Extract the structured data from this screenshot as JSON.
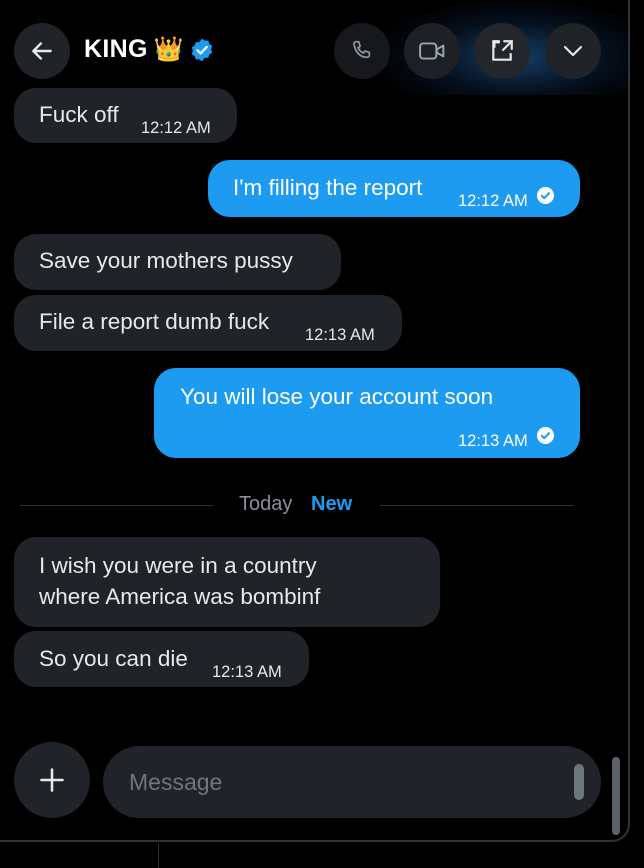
{
  "header": {
    "title": "KING",
    "title_emoji": "👑",
    "icons": [
      "back-arrow-icon",
      "phone-icon",
      "video-camera-icon",
      "expand-icon",
      "chevron-down-icon"
    ],
    "accent_color": "#1d9bf0"
  },
  "messages": [
    {
      "direction": "in",
      "text": "Fuck off",
      "time": "12:12 AM"
    },
    {
      "direction": "out",
      "text": "I'm filling the report",
      "time": "12:12 AM",
      "read": true
    },
    {
      "direction": "in",
      "text": "Save your mothers pussy"
    },
    {
      "direction": "in",
      "text": "File a report dumb fuck",
      "time": "12:13 AM"
    },
    {
      "direction": "out",
      "text": "You will lose your account soon",
      "time": "12:13 AM",
      "read": true
    },
    {
      "direction": "in",
      "lines": [
        "I wish you were in a country",
        "where America was bombinf"
      ]
    },
    {
      "direction": "in",
      "text": "So you can die",
      "time": "12:13 AM"
    }
  ],
  "divider": {
    "label": "Today",
    "badge": "New"
  },
  "composer": {
    "placeholder": "Message"
  },
  "colors": {
    "incoming_bubble": "#202327",
    "outgoing_bubble": "#1d9bf0",
    "background": "#000000"
  }
}
